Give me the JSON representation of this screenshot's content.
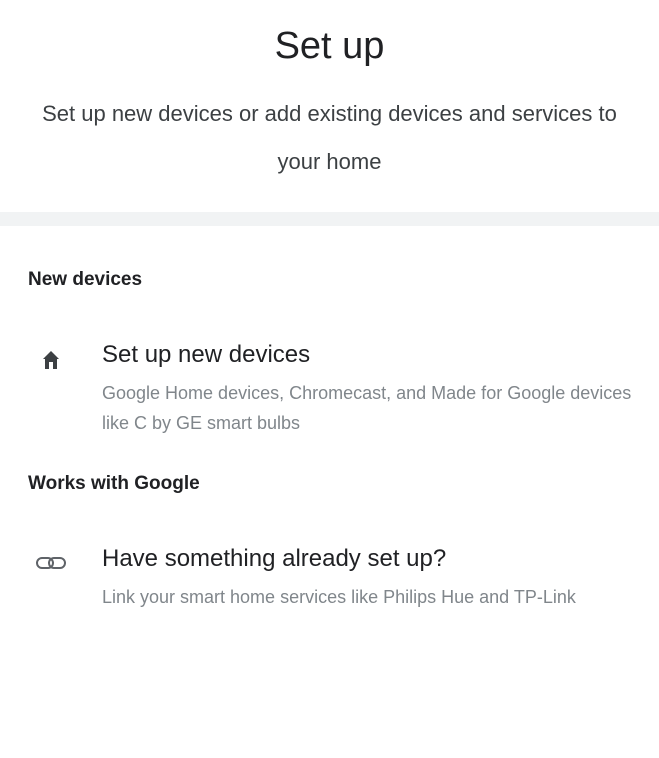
{
  "header": {
    "title": "Set up",
    "subtitle": "Set up new devices or add existing devices and services to your home"
  },
  "sections": [
    {
      "title": "New devices",
      "item": {
        "icon": "home-icon",
        "title": "Set up new devices",
        "description": "Google Home devices, Chromecast, and Made for Google devices like C by GE smart bulbs"
      }
    },
    {
      "title": "Works with Google",
      "item": {
        "icon": "link-icon",
        "title": "Have something already set up?",
        "description": "Link your smart home services like Philips Hue and TP-Link"
      }
    }
  ],
  "colors": {
    "divider": "#f1f3f4",
    "text_primary": "#202124",
    "text_secondary": "#80868b",
    "icon_home": "#3c4043",
    "icon_link": "#5f6368"
  }
}
